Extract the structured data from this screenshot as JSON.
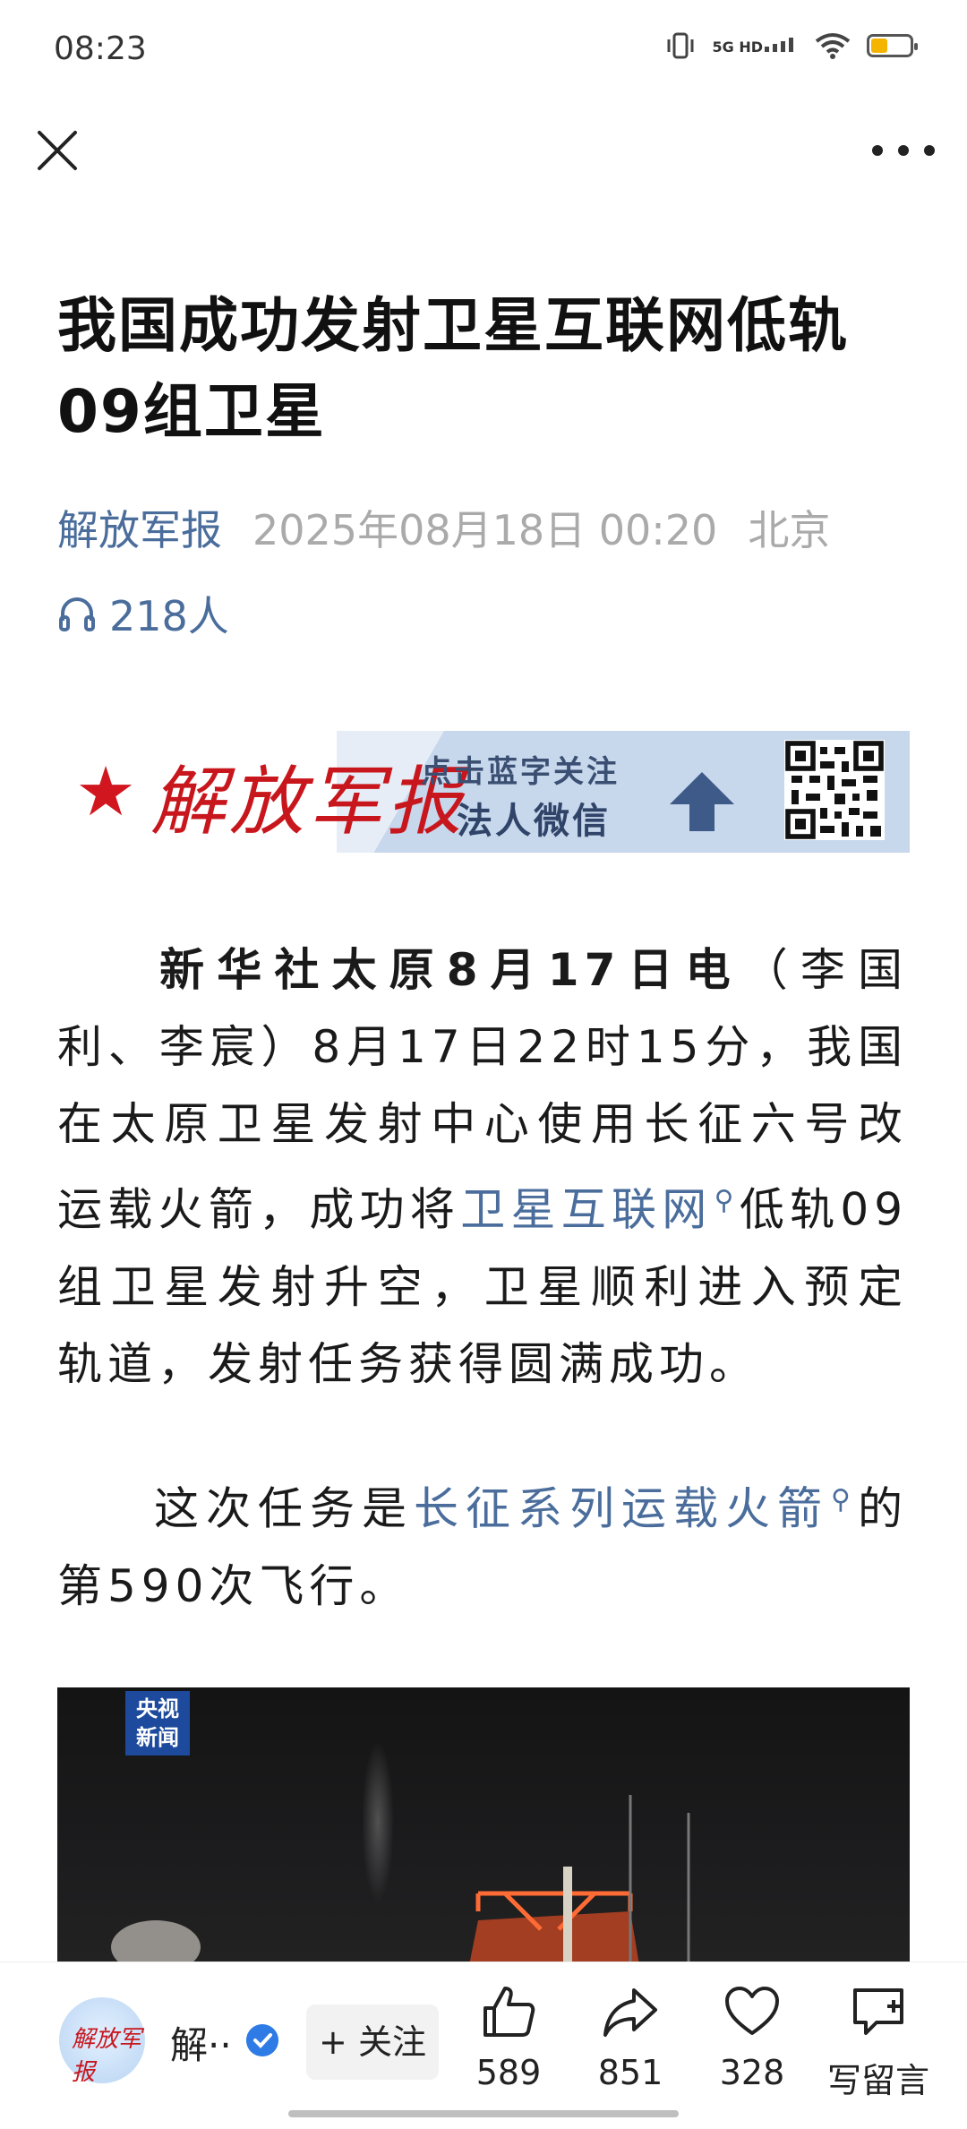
{
  "status": {
    "time": "08:23",
    "network": "5G HD"
  },
  "article": {
    "title": "我国成功发射卫星互联网低轨09组卫星",
    "source": "解放军报",
    "date": "2025年08月18日 00:20",
    "location": "北京",
    "listeners": "218人"
  },
  "banner": {
    "logo_text": "解放军报",
    "cta_line1": "点击蓝字关注",
    "cta_line2": "法人微信"
  },
  "body": {
    "p1_bold": "新华社太原8月17日电",
    "p1_text_a": "（李国利、李宸）8月17日22时15分，我国在太原卫星发射中心使用长征六号改运载火箭，成功将",
    "p1_link": "卫星互联网",
    "p1_text_b": "低轨09组卫星发射升空，卫星顺利进入预定轨道，发射任务获得圆满成功。",
    "p2_text_a": "这次任务是",
    "p2_link": "长征系列运载火箭",
    "p2_text_b": "的第590次飞行。"
  },
  "photo": {
    "watermark": "央视\n新闻"
  },
  "bottom": {
    "author": "解··",
    "follow_label": "+ 关注",
    "likes": "589",
    "shares": "851",
    "favorites": "328",
    "comment_label": "写留言"
  },
  "colors": {
    "link": "#4a6d9c",
    "brand_red": "#c8161d",
    "verified": "#2e7be6"
  }
}
